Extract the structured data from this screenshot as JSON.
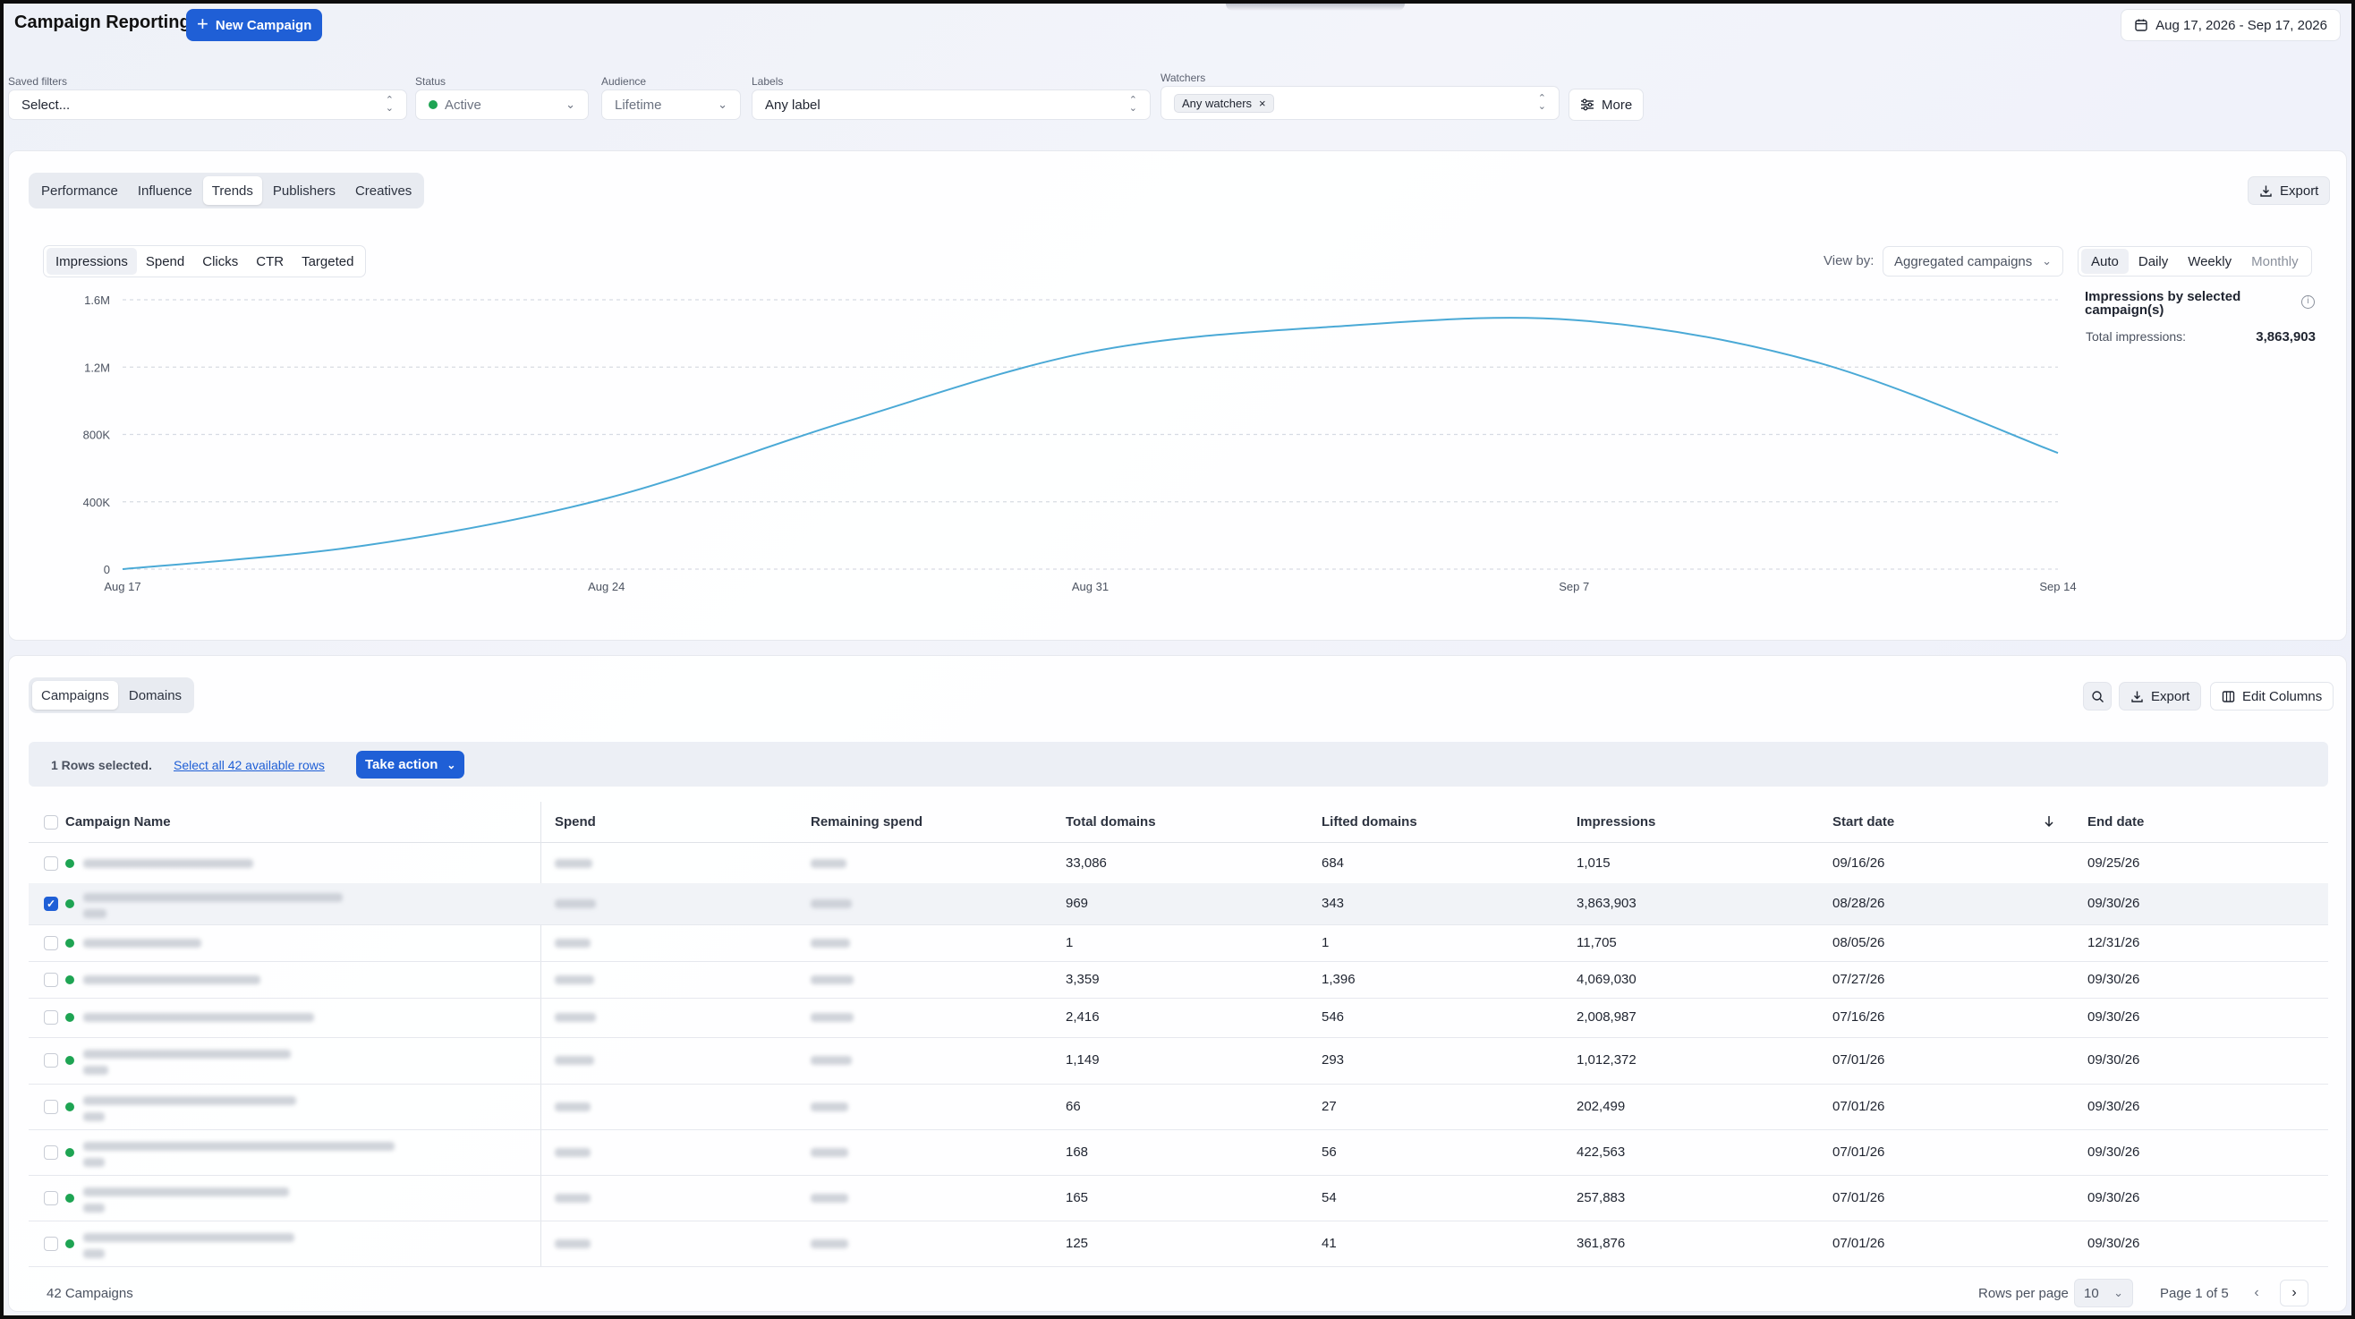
{
  "header": {
    "title": "Campaign Reporting",
    "new_campaign": "New Campaign",
    "date_range": "Aug 17, 2026 - Sep 17, 2026"
  },
  "filters": {
    "saved_filters": {
      "label": "Saved filters",
      "value": "Select..."
    },
    "status": {
      "label": "Status",
      "value": "Active"
    },
    "audience": {
      "label": "Audience",
      "value": "Lifetime"
    },
    "labels": {
      "label": "Labels",
      "value": "Any label"
    },
    "watchers": {
      "label": "Watchers",
      "chip": "Any watchers"
    },
    "more": "More"
  },
  "report_tabs": [
    "Performance",
    "Influence",
    "Trends",
    "Publishers",
    "Creatives"
  ],
  "report_tab_active": 2,
  "export_label": "Export",
  "metrics": [
    "Impressions",
    "Spend",
    "Clicks",
    "CTR",
    "Targeted"
  ],
  "metric_active": 0,
  "view_by": {
    "label": "View by:",
    "value": "Aggregated campaigns"
  },
  "periods": [
    "Auto",
    "Daily",
    "Weekly",
    "Monthly"
  ],
  "period_active": 0,
  "side_panel": {
    "title": "Impressions by selected campaign(s)",
    "total_label": "Total impressions:",
    "total_value": "3,863,903"
  },
  "chart_data": {
    "type": "line",
    "x": [
      "Aug 17",
      "Aug 20",
      "Aug 24",
      "Aug 27",
      "Aug 31",
      "Sep 3",
      "Sep 7",
      "Sep 10",
      "Sep 14"
    ],
    "x_ticks": [
      "Aug 17",
      "Aug 24",
      "Aug 31",
      "Sep 7",
      "Sep 14"
    ],
    "series": [
      {
        "values": [
          0,
          140000,
          420000,
          880000,
          1290000,
          1440000,
          1480000,
          1230000,
          690000
        ]
      }
    ],
    "y_ticks": [
      "0",
      "400K",
      "800K",
      "1.2M",
      "1.6M"
    ],
    "ylim": [
      0,
      1600000
    ],
    "grid": true,
    "color": "#4aa9d6"
  },
  "table_tabs": [
    "Campaigns",
    "Domains"
  ],
  "table_tab_active": 0,
  "toolbar": {
    "export": "Export",
    "edit_columns": "Edit Columns"
  },
  "selection": {
    "text": "1 Rows selected.",
    "select_all": "Select all 42 available rows",
    "take_action": "Take action"
  },
  "columns": [
    "Campaign Name",
    "Spend",
    "Remaining spend",
    "Total domains",
    "Lifted domains",
    "Impressions",
    "Start date",
    "End date"
  ],
  "rows": [
    {
      "total_domains": "33,086",
      "lifted_domains": "684",
      "impressions": "1,015",
      "start": "09/16/26",
      "end": "09/25/26",
      "checked": false
    },
    {
      "total_domains": "969",
      "lifted_domains": "343",
      "impressions": "3,863,903",
      "start": "08/28/26",
      "end": "09/30/26",
      "checked": true
    },
    {
      "total_domains": "1",
      "lifted_domains": "1",
      "impressions": "11,705",
      "start": "08/05/26",
      "end": "12/31/26",
      "checked": false
    },
    {
      "total_domains": "3,359",
      "lifted_domains": "1,396",
      "impressions": "4,069,030",
      "start": "07/27/26",
      "end": "09/30/26",
      "checked": false
    },
    {
      "total_domains": "2,416",
      "lifted_domains": "546",
      "impressions": "2,008,987",
      "start": "07/16/26",
      "end": "09/30/26",
      "checked": false
    },
    {
      "total_domains": "1,149",
      "lifted_domains": "293",
      "impressions": "1,012,372",
      "start": "07/01/26",
      "end": "09/30/26",
      "checked": false
    },
    {
      "total_domains": "66",
      "lifted_domains": "27",
      "impressions": "202,499",
      "start": "07/01/26",
      "end": "09/30/26",
      "checked": false
    },
    {
      "total_domains": "168",
      "lifted_domains": "56",
      "impressions": "422,563",
      "start": "07/01/26",
      "end": "09/30/26",
      "checked": false
    },
    {
      "total_domains": "165",
      "lifted_domains": "54",
      "impressions": "257,883",
      "start": "07/01/26",
      "end": "09/30/26",
      "checked": false
    },
    {
      "total_domains": "125",
      "lifted_domains": "41",
      "impressions": "361,876",
      "start": "07/01/26",
      "end": "09/30/26",
      "checked": false
    }
  ],
  "footer": {
    "count": "42 Campaigns",
    "rows_per_page_label": "Rows per page",
    "rows_per_page": "10",
    "page": "Page 1 of 5"
  }
}
